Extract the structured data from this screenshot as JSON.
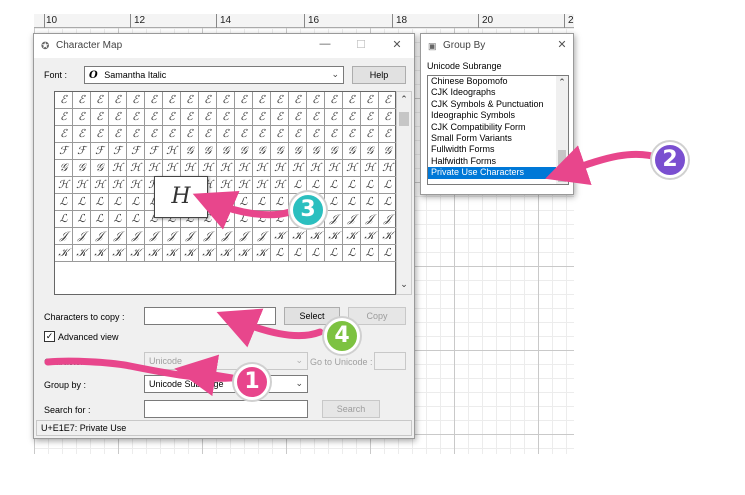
{
  "ruler": {
    "n10": "10",
    "n12": "12",
    "n14": "14",
    "n16": "16",
    "n18": "18",
    "n20": "20",
    "n22": "2"
  },
  "charmap": {
    "title": "Character Map",
    "font_label": "Font :",
    "font_value": "Samantha Italic",
    "font_icon": "O",
    "help_label": "Help",
    "chars_to_copy_label": "Characters to copy :",
    "chars_to_copy_value": "",
    "select_label": "Select",
    "copy_label": "Copy",
    "advanced_view_label": "Advanced view",
    "character_set_label": "Character set :",
    "character_set_value": "Unicode",
    "go_to_unicode_label": "Go to Unicode :",
    "group_by_label": "Group by :",
    "group_by_value": "Unicode Subrange",
    "search_for_label": "Search for :",
    "search_label": "Search",
    "status": "U+E1E7: Private Use",
    "zoom_glyph": "H",
    "glyph_rows": [
      "ℰℰℰℰℰℰℰℰℰℰℰℰℰℰℰℰℰℰℰ",
      "ℰℰℰℰℰℰℰℰℰℰℰℰℰℰℰℰℰℰℰ",
      "ℰℰℰℰℰℰℰℰℰℰℰℰℰℰℰℰℰℰℰ",
      "ℱℱℱℱℱℱℋ𝒢𝒢𝒢𝒢𝒢𝒢𝒢𝒢𝒢𝒢𝒢𝒢",
      "𝒢𝒢𝒢ℋℋℋℋℋℋℋℋℋℋℋℋℋℋℋℋ",
      "ℋℋℋℋℋℋℋℋℋℋℋℋℋℒℒℒℒℒℒ",
      "ℒℒℒℒℒℒℒℒℒℒℒℒℒℒℒℒℒℒℒ",
      "ℒℒℒℒℒℒℒℒℒℒℒℒℒℒ𝒥𝒥𝒥𝒥𝒥",
      "𝒥𝒥𝒥𝒥𝒥𝒥𝒥𝒥𝒥𝒥𝒥𝒥𝒦𝒦𝒦𝒦𝒦𝒦𝒦",
      "𝒦𝒦𝒦𝒦𝒦𝒦𝒦𝒦𝒦𝒦𝒦𝒦ℒℒℒℒℒℒℒ"
    ]
  },
  "groupby": {
    "title": "Group By",
    "heading": "Unicode Subrange",
    "items": [
      "Chinese Bopomofo",
      "CJK Ideographs",
      "CJK Symbols & Punctuation",
      "Ideographic Symbols",
      "CJK Compatibility Form",
      "Small Form Variants",
      "Fullwidth Forms",
      "Halfwidth Forms",
      "Private Use Characters"
    ],
    "selected_index": 8
  },
  "annotations": {
    "badge1": "1",
    "badge2": "2",
    "badge3": "3",
    "badge4": "4",
    "color_pink": "#e8468c",
    "color_violet": "#7a4fd0",
    "color_teal": "#2bbfbf",
    "color_green": "#7dc241"
  }
}
